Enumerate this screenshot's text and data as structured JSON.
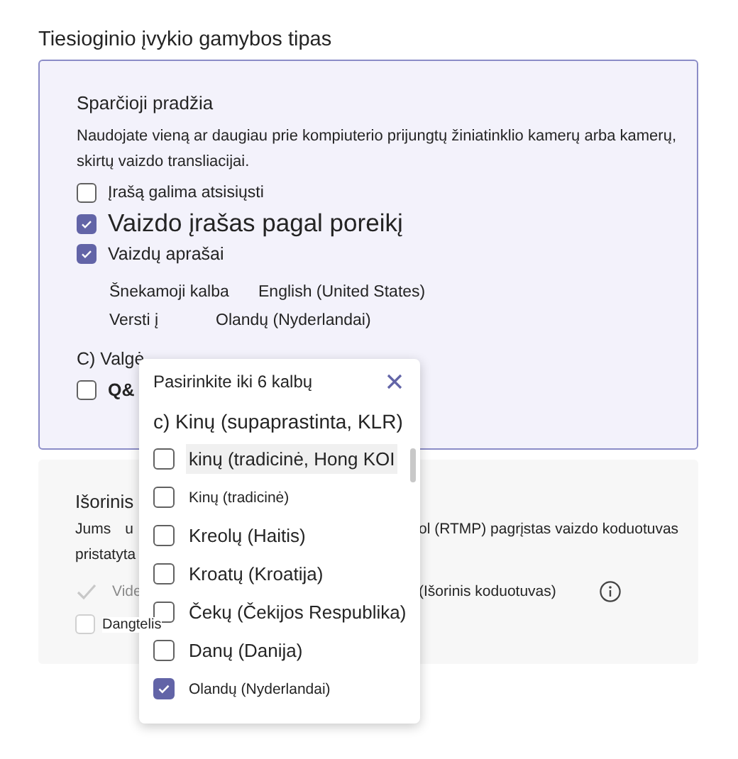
{
  "section_title": "Tiesioginio įvykio gamybos tipas",
  "quick_start": {
    "title": "Sparčioji pradžia",
    "description": "Naudojate vieną ar daugiau prie kompiuterio prijungtų žiniatinklio kamerų arba kamerų, skirtų vaizdo transliacijai.",
    "options": [
      {
        "label": "Įrašą galima atsisiųsti",
        "checked": false,
        "kind": "small"
      },
      {
        "label": "Vaizdo įrašas pagal poreikį",
        "checked": true,
        "kind": "large"
      },
      {
        "label": "Vaizdų aprašai",
        "checked": true,
        "kind": "medium"
      }
    ],
    "settings": [
      {
        "label": "Šnekamoji kalba",
        "value": "English (United States)"
      },
      {
        "label": "Versti į",
        "value": "Olandų (Nyderlandai)"
      }
    ],
    "cut_label": "C) Valgė",
    "qa": {
      "label": "Q&",
      "checked": false
    }
  },
  "external": {
    "title": "Išorinis",
    "line1_left": [
      "Jums",
      "u"
    ],
    "line1_right": "ol (RTMP) pagrįstas vaizdo koduotuvas",
    "line2": "pristatyta",
    "video": {
      "label": "Vide",
      "suffix": "(Išorinis koduotuvas)",
      "checked": true
    },
    "lid": {
      "label": "Dangtelis",
      "checked": false
    }
  },
  "language_popup": {
    "title": "Pasirinkite iki 6 kalbų",
    "heading_item": "c) Kinų (supaprastinta, KLR)",
    "items": [
      {
        "label": "kinų (tradicinė, Hong KOI",
        "checked": false,
        "highlighted": true,
        "kind": "large"
      },
      {
        "label": "Kinų (tradicinė)",
        "checked": false,
        "highlighted": false,
        "kind": "small"
      },
      {
        "label": "Kreolų (Haitis)",
        "checked": false,
        "highlighted": false,
        "kind": "large"
      },
      {
        "label": "Kroatų (Kroatija)",
        "checked": false,
        "highlighted": false,
        "kind": "large"
      },
      {
        "label": "Čekų (Čekijos Respublika)",
        "checked": false,
        "highlighted": false,
        "kind": "large"
      },
      {
        "label": "Danų (Danija)",
        "checked": false,
        "highlighted": false,
        "kind": "large"
      },
      {
        "label": "Olandų (Nyderlandai)",
        "checked": true,
        "highlighted": false,
        "kind": "small"
      }
    ]
  }
}
